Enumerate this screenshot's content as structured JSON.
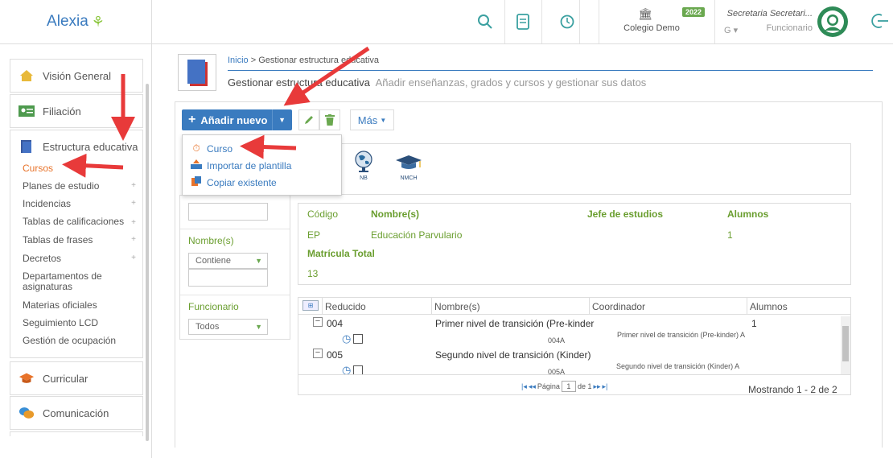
{
  "app": {
    "logo_text": "Alexia",
    "logo_mark": "ꟃ"
  },
  "header": {
    "school_name": "Colegio Demo",
    "year_badge": "2022",
    "user_name": "Secretaria Secretari...",
    "user_role": "Funcionario",
    "user_g": "G"
  },
  "sidebar": {
    "vision_general": "Visión General",
    "filiacion": "Filiación",
    "estructura": "Estructura educativa",
    "sub_items": [
      "Cursos",
      "Planes de estudio",
      "Incidencias",
      "Tablas de calificaciones",
      "Tablas de frases",
      "Decretos",
      "Departamentos de asignaturas",
      "Materias oficiales",
      "Seguimiento LCD",
      "Gestión de ocupación"
    ],
    "curricular": "Curricular",
    "comunicacion": "Comunicación"
  },
  "breadcrumb": {
    "home": "Inicio",
    "separator": ">",
    "current": "Gestionar estructura educativa"
  },
  "page": {
    "title": "Gestionar estructura educativa",
    "subtitle": "Añadir enseñanzas, grados y cursos y gestionar sus datos"
  },
  "toolbar": {
    "add_label": "Añadir nuevo",
    "more_label": "Más"
  },
  "dropdown": {
    "items": [
      "Curso",
      "Importar de plantilla",
      "Copiar existente"
    ]
  },
  "levels": {
    "items": [
      "NB",
      "NMCH"
    ]
  },
  "filters": {
    "nombre_label": "Nombre(s)",
    "nombre_mode": "Contiene",
    "funcionario_label": "Funcionario",
    "funcionario_value": "Todos"
  },
  "detail": {
    "headers": {
      "codigo": "Código",
      "nombre": "Nombre(s)",
      "jefe": "Jefe de estudios",
      "alumnos": "Alumnos",
      "matricula": "Matrícula Total"
    },
    "codigo": "EP",
    "nombre": "Educación Parvulario",
    "alumnos": "1",
    "matricula": "13"
  },
  "grid": {
    "columns": [
      "Reducido",
      "Nombre(s)",
      "Coordinador",
      "Alumnos"
    ],
    "rows": [
      {
        "code": "004",
        "name": "Primer nivel de transición (Pre-kinder",
        "alumnos": "1",
        "child_code": "004A",
        "child_name": "Primer nivel de transición (Pre-kinder) A"
      },
      {
        "code": "005",
        "name": "Segundo nivel de transición (Kinder)",
        "alumnos": "",
        "child_code": "005A",
        "child_name": "Segundo nivel de transición (Kinder) A"
      }
    ],
    "pager": {
      "page_label": "Página",
      "page": "1",
      "of_label": "de 1"
    },
    "showing": "Mostrando 1 - 2 de 2"
  },
  "colors": {
    "accent": "#3a7bbf",
    "green": "#6a9e2f",
    "selected": "#e8732a",
    "arrow": "#e83a3a"
  }
}
